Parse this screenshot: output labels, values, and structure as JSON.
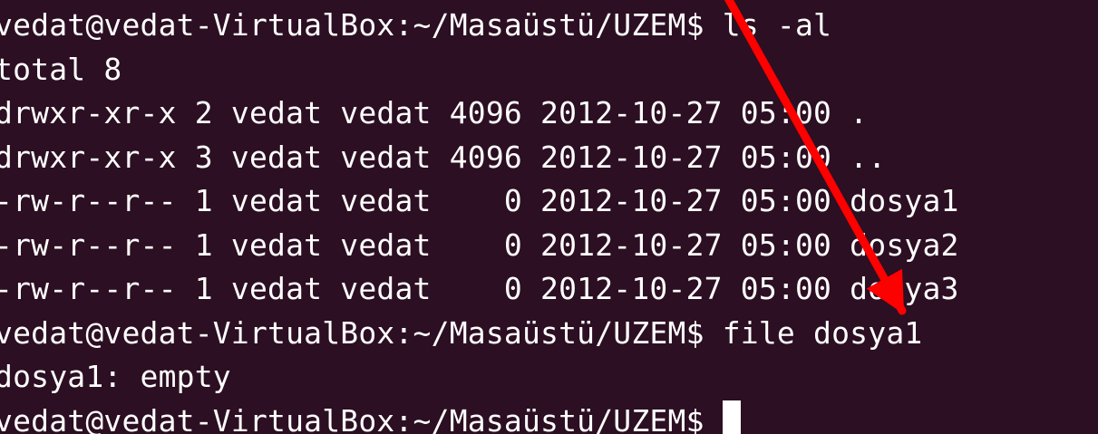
{
  "terminal": {
    "lines": [
      "vedat@vedat-VirtualBox:~/Masaüstü/UZEM$ ls -al",
      "total 8",
      "drwxr-xr-x 2 vedat vedat 4096 2012-10-27 05:00 .",
      "drwxr-xr-x 3 vedat vedat 4096 2012-10-27 05:00 ..",
      "-rw-r--r-- 1 vedat vedat    0 2012-10-27 05:00 dosya1",
      "-rw-r--r-- 1 vedat vedat    0 2012-10-27 05:00 dosya2",
      "-rw-r--r-- 1 vedat vedat    0 2012-10-27 05:00 dosya3",
      "vedat@vedat-VirtualBox:~/Masaüstü/UZEM$ file dosya1",
      "dosya1: empty"
    ],
    "prompt": "vedat@vedat-VirtualBox:~/Masaüstü/UZEM$ ",
    "background_color": "#2c0f22",
    "text_color": "#ffffff"
  },
  "annotation": {
    "arrow_color": "#ff0000"
  }
}
